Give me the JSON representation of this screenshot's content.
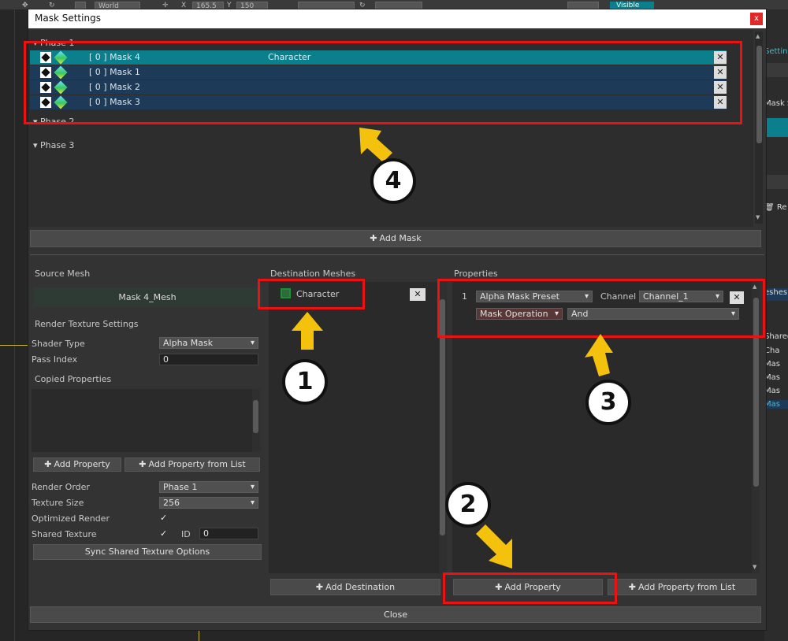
{
  "editor": {
    "world_label": "World",
    "x_label": "X",
    "x_value": "165.5",
    "y_label": "Y",
    "y_value": "150",
    "visible_label": "Visible",
    "right_panel": {
      "settings_tab": "Settin",
      "mask_tab": "Mask S",
      "remove_label": "Re",
      "meshes_label": "eshes",
      "shared_label": "Shared",
      "items": [
        "Cha",
        "Mas",
        "Mas",
        "Mas",
        "Mas"
      ]
    }
  },
  "dialog": {
    "title": "Mask Settings",
    "close_symbol": "x",
    "phases": [
      {
        "label": "Phase 1"
      },
      {
        "label": "Phase 2"
      },
      {
        "label": "Phase 3"
      }
    ],
    "masks": [
      {
        "label": "[ 0 ] Mask 4",
        "destination": "Character",
        "selected": true
      },
      {
        "label": "[ 0 ] Mask 1",
        "destination": "",
        "selected": false
      },
      {
        "label": "[ 0 ] Mask 2",
        "destination": "",
        "selected": false
      },
      {
        "label": "[ 0 ] Mask 3",
        "destination": "",
        "selected": false
      }
    ],
    "add_mask_label": "Add Mask",
    "source_mesh": {
      "title": "Source Mesh",
      "mesh_name": "Mask 4_Mesh"
    },
    "render_texture": {
      "title": "Render Texture Settings",
      "shader_type_label": "Shader Type",
      "shader_type_value": "Alpha Mask",
      "pass_index_label": "Pass Index",
      "pass_index_value": "0",
      "copied_properties_label": "Copied Properties",
      "add_property_label": "Add Property",
      "add_property_from_list_label": "Add Property from List",
      "render_order_label": "Render Order",
      "render_order_value": "Phase 1",
      "texture_size_label": "Texture Size",
      "texture_size_value": "256",
      "optimized_render_label": "Optimized Render",
      "optimized_render_checked": "✓",
      "shared_texture_label": "Shared Texture",
      "shared_texture_checked": "✓",
      "id_label": "ID",
      "id_value": "0",
      "sync_label": "Sync Shared Texture Options"
    },
    "destination": {
      "title": "Destination Meshes",
      "items": [
        {
          "label": "Character"
        }
      ],
      "add_destination_label": "Add Destination"
    },
    "properties": {
      "title": "Properties",
      "rows": [
        {
          "index": "1",
          "preset": "Alpha Mask Preset",
          "channel_label": "Channel",
          "channel_value": "Channel_1",
          "operation": "Mask Operation",
          "operation_value": "And"
        }
      ],
      "add_property_label": "Add Property",
      "add_property_from_list_label": "Add Property from List"
    },
    "close_label": "Close"
  },
  "annotations": {
    "callouts": [
      "1",
      "2",
      "3",
      "4"
    ],
    "highlight_color": "#ee1111",
    "arrow_color": "#f4c20d"
  }
}
